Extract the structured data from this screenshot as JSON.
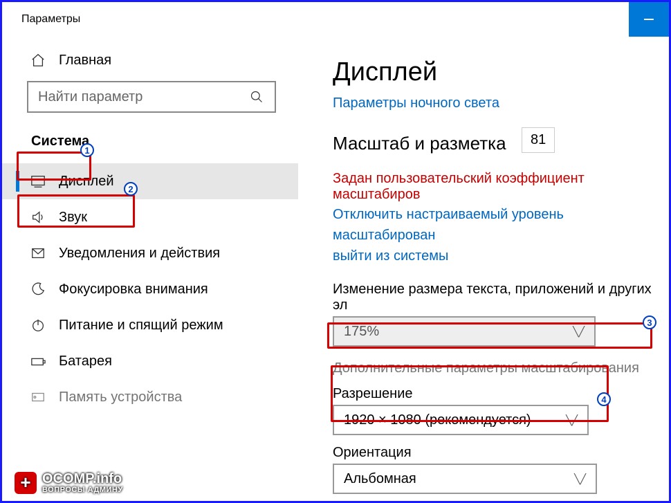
{
  "window": {
    "title": "Параметры"
  },
  "sidebar": {
    "home": "Главная",
    "search_placeholder": "Найти параметр",
    "group": "Система",
    "items": [
      {
        "label": "Дисплей"
      },
      {
        "label": "Звук"
      },
      {
        "label": "Уведомления и действия"
      },
      {
        "label": "Фокусировка внимания"
      },
      {
        "label": "Питание и спящий режим"
      },
      {
        "label": "Батарея"
      },
      {
        "label": "Память устройства"
      }
    ]
  },
  "main": {
    "title": "Дисплей",
    "night_link": "Параметры ночного света",
    "scale_heading": "Масштаб и разметка",
    "scale_value": "81",
    "warning": "Задан пользовательский коэффициент масштабиров",
    "turnoff_line1": "Отключить настраиваемый уровень масштабирован",
    "turnoff_line2": "выйти из системы",
    "resize_label": "Изменение размера текста, приложений и других эл",
    "resize_value": "175%",
    "advanced_scaling": "Дополнительные параметры масштабирования",
    "resolution_label": "Разрешение",
    "resolution_value": "1920 × 1080 (рекомендуется)",
    "orientation_label": "Ориентация",
    "orientation_value": "Альбомная"
  },
  "watermark": {
    "text": "OCOMP.info",
    "sub": "ВОПРОСЫ АДМИНУ"
  },
  "badges": {
    "b1": "1",
    "b2": "2",
    "b3": "3",
    "b4": "4"
  }
}
